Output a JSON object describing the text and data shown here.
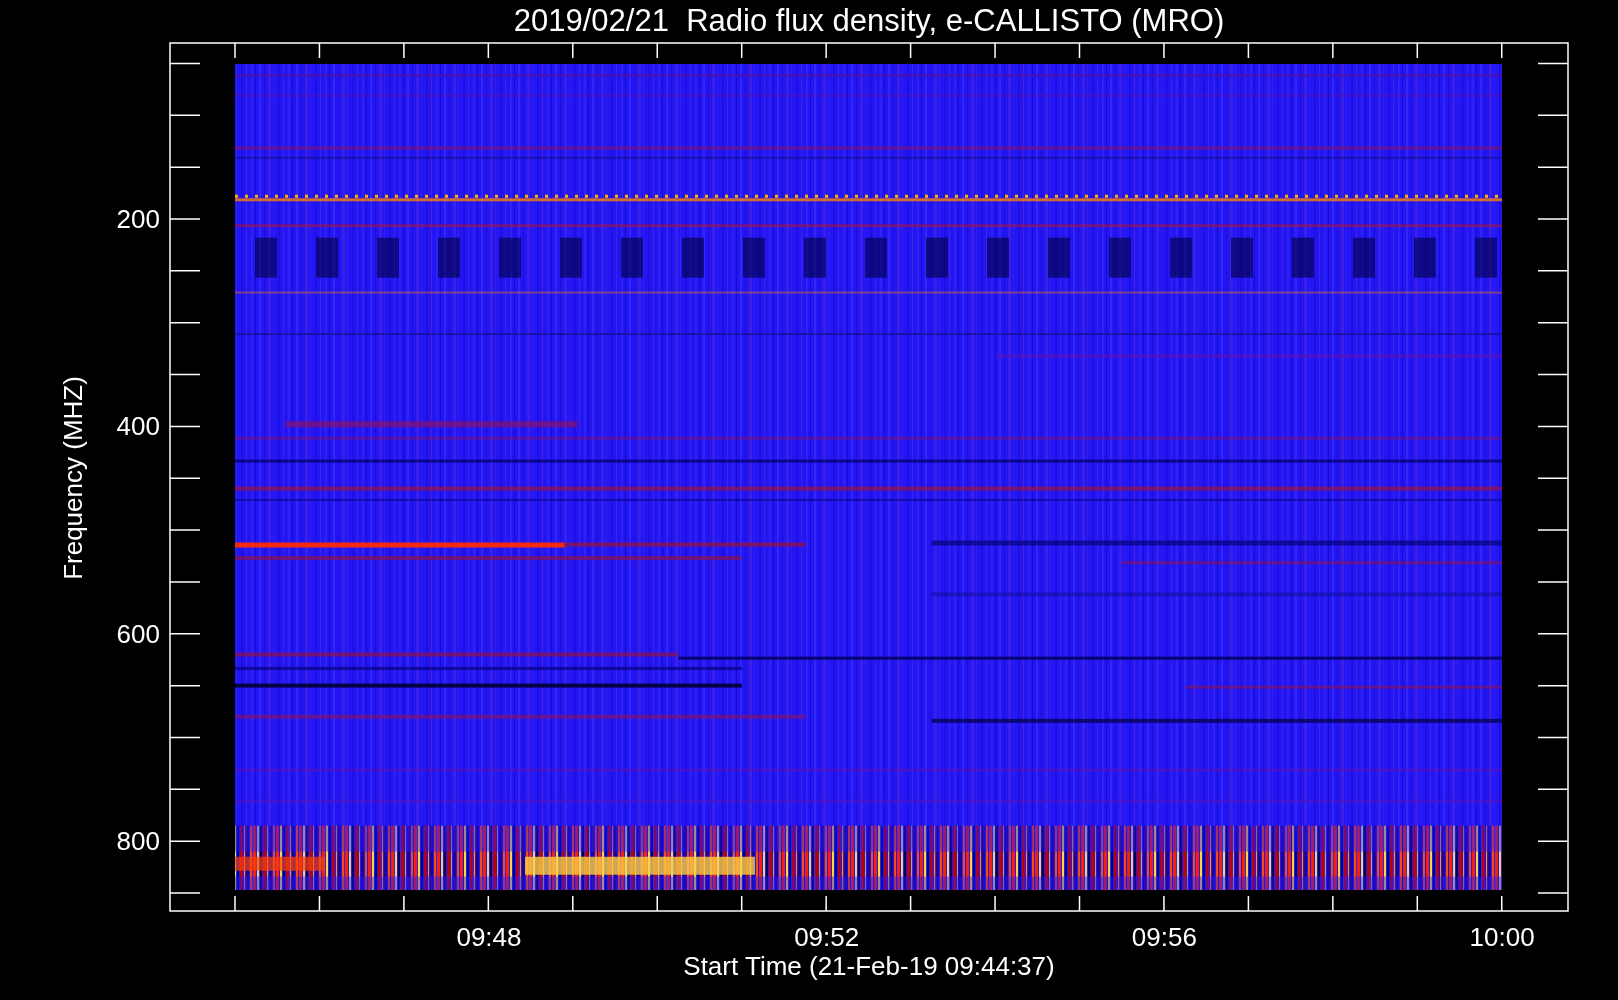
{
  "title": "2019/02/21  Radio flux density, e-CALLISTO (MRO)",
  "y_axis": {
    "label": "Frequency (MHZ)",
    "ticks": [
      "200",
      "400",
      "600",
      "800"
    ]
  },
  "x_axis": {
    "label": "Start Time (21-Feb-19 09:44:37)",
    "ticks": [
      "09:48",
      "09:52",
      "09:56",
      "10:00"
    ]
  }
}
